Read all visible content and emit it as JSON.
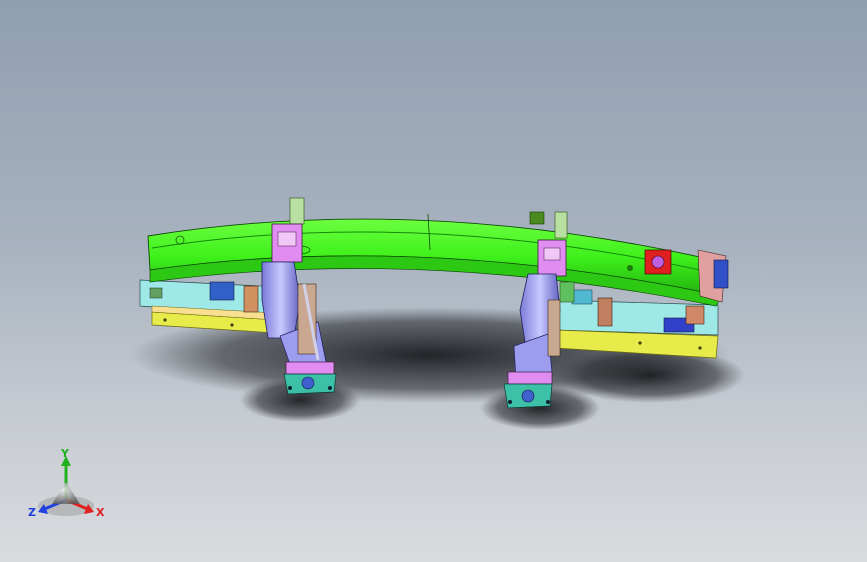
{
  "viewport": {
    "background_top": "#8f9eb1",
    "background_bottom": "#d9dcdf"
  },
  "model": {
    "beam_color": "#3ef01a",
    "base_plate_color": "#e8ec4a",
    "clamp_color": "#9d9df0",
    "riser_color": "#e08cf0",
    "foot_color": "#3cc0a8"
  },
  "triad": {
    "x_label": "X",
    "y_label": "Y",
    "z_label": "Z",
    "x_color": "#e02020",
    "y_color": "#20b020",
    "z_color": "#2040e0"
  }
}
